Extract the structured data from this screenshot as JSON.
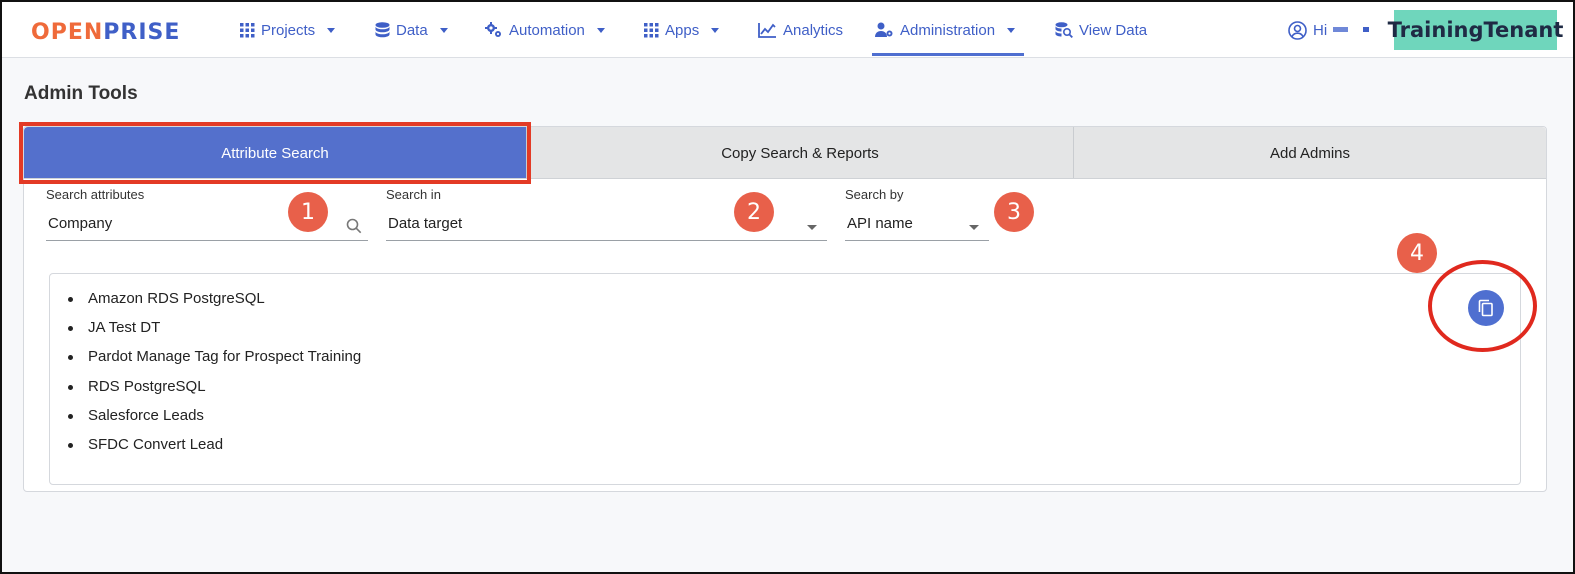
{
  "nav": {
    "logo_part1": "OPEN",
    "logo_part2": "PRISE",
    "projects": "Projects",
    "data": "Data",
    "automation": "Automation",
    "apps": "Apps",
    "analytics": "Analytics",
    "administration": "Administration",
    "view_data": "View Data",
    "greeting": "Hi",
    "tenant": "TrainingTenant",
    "accent": "#3f5fc7"
  },
  "page": {
    "title": "Admin Tools"
  },
  "tabs": [
    {
      "label": "Attribute Search"
    },
    {
      "label": "Copy Search & Reports"
    },
    {
      "label": "Add Admins"
    }
  ],
  "search": {
    "attributes_label": "Search attributes",
    "attributes_value": "Company",
    "search_in_label": "Search in",
    "search_in_value": "Data target",
    "search_by_label": "Search by",
    "search_by_value": "API name"
  },
  "results": [
    "Amazon RDS PostgreSQL",
    "JA Test DT",
    "Pardot Manage Tag for Prospect Training",
    "RDS PostgreSQL",
    "Salesforce Leads",
    "SFDC Convert Lead"
  ],
  "callouts": [
    "1",
    "2",
    "3",
    "4"
  ],
  "icons": {
    "copy": "copy-icon",
    "search": "search-icon"
  }
}
